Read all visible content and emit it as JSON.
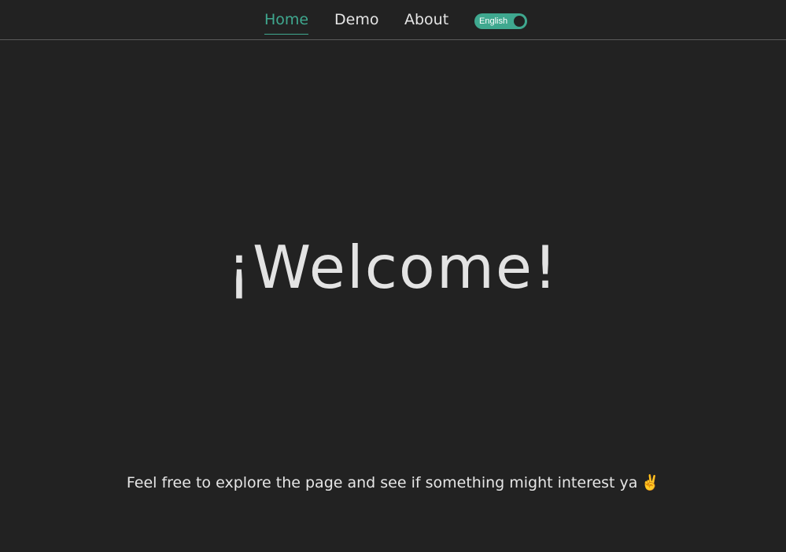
{
  "nav": {
    "items": [
      {
        "label": "Home",
        "active": true
      },
      {
        "label": "Demo",
        "active": false
      },
      {
        "label": "About",
        "active": false
      }
    ],
    "language_toggle": {
      "label": "English"
    }
  },
  "hero": {
    "title": "¡Welcome!",
    "subtitle": "Feel free to explore the page and see if something might interest ya",
    "subtitle_emoji": "✌️"
  },
  "colors": {
    "background": "#222222",
    "accent": "#3fa88f",
    "text": "#e6e6e6",
    "divider": "#5a5a5a"
  }
}
